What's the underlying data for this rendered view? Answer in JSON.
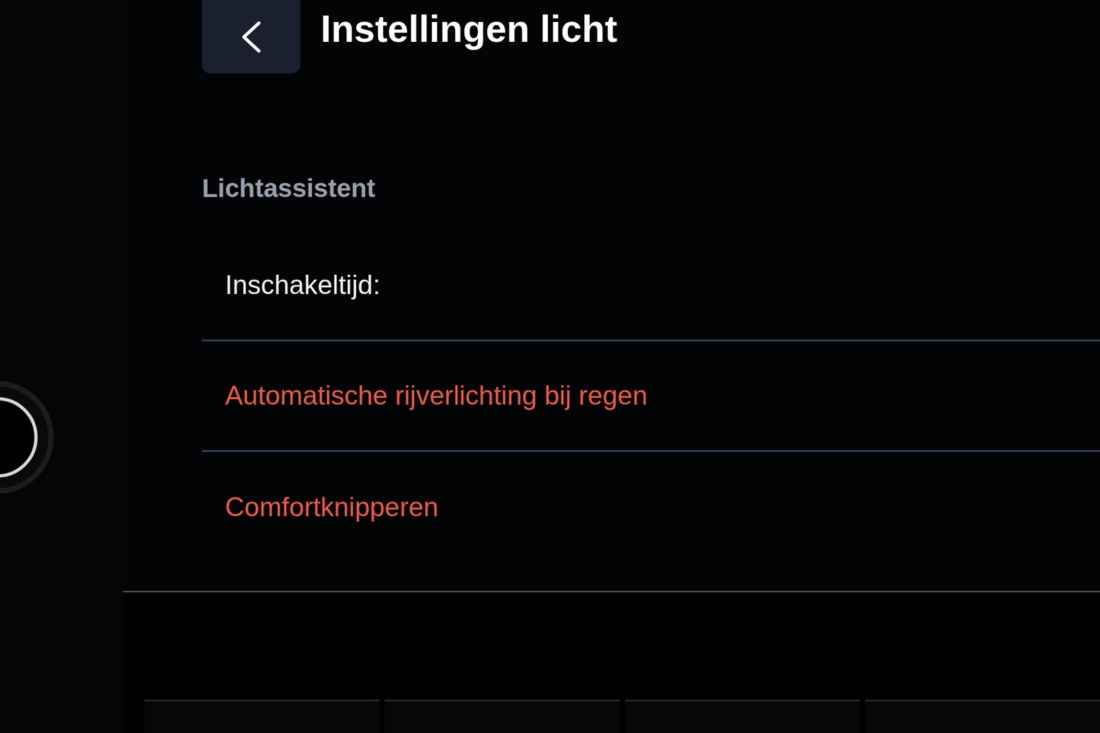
{
  "screen": {
    "title": "Instellingen licht"
  },
  "section": {
    "header": "Lichtassistent"
  },
  "items": [
    {
      "label": "Inschakeltijd:",
      "color": "#f2f2f2"
    },
    {
      "label": "Automatische rijverlichting bij regen",
      "color": "#ec5a43"
    },
    {
      "label": "Comfortknipperen",
      "color": "#ec5a43"
    }
  ]
}
